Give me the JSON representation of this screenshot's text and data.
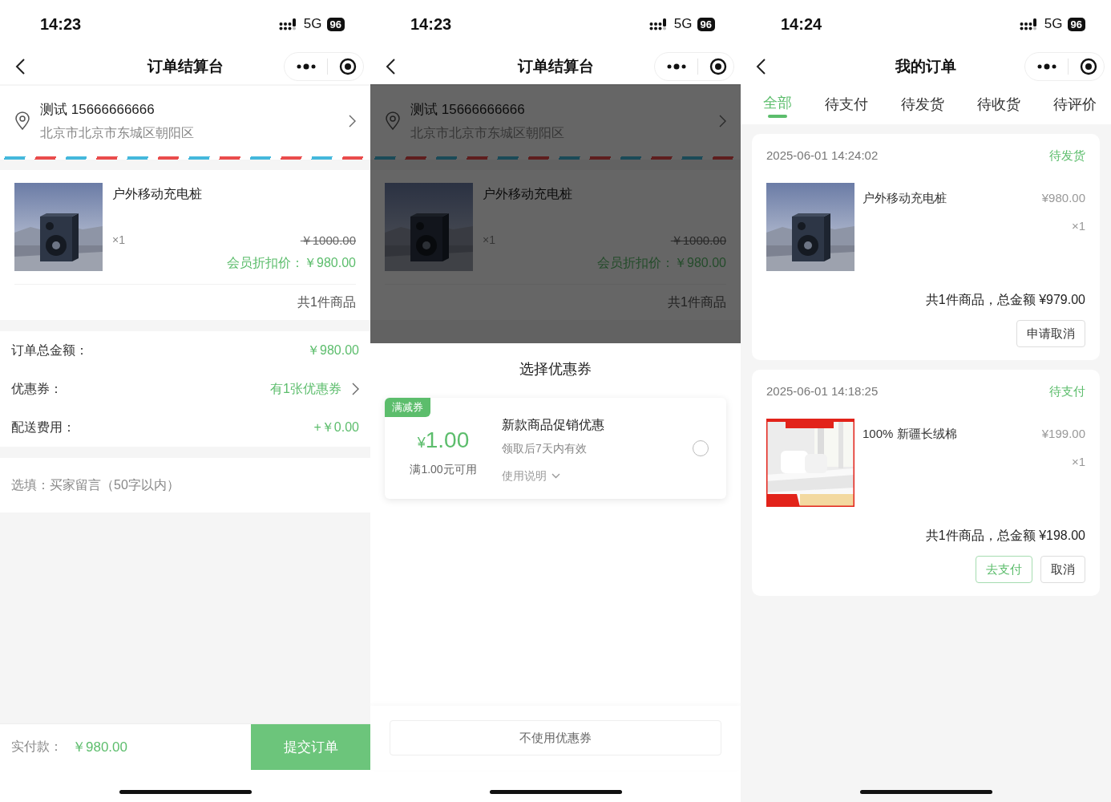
{
  "screens": [
    {
      "kind": "checkout",
      "status": {
        "time": "14:23",
        "network": "5G",
        "battery": "96"
      },
      "title": "订单结算台",
      "address": {
        "name": "测试 15666666666",
        "detail": "北京市北京市东城区朝阳区"
      },
      "items": [
        {
          "name": "户外移动充电桩",
          "qty": "×1",
          "original_price": "￥1000.00",
          "member_price": "会员折扣价：￥980.00"
        }
      ],
      "item_count": "共1件商品",
      "summary": [
        {
          "label": "订单总金额：",
          "value": "￥980.00",
          "link": false
        },
        {
          "label": "优惠券：",
          "value": "有1张优惠券",
          "link": true
        },
        {
          "label": "配送费用：",
          "value": "+￥0.00",
          "link": false
        }
      ],
      "note": {
        "placeholder": "选填：买家留言（50字以内）"
      },
      "footer": {
        "label": "实付款：",
        "amount": "￥980.00",
        "button": "提交订单"
      }
    },
    {
      "kind": "coupon_sheet",
      "status": {
        "time": "14:23",
        "network": "5G",
        "battery": "96"
      },
      "title": "订单结算台",
      "address": {
        "name": "测试 15666666666",
        "detail": "北京市北京市东城区朝阳区"
      },
      "items": [
        {
          "name": "户外移动充电桩",
          "qty": "×1",
          "original_price": "￥1000.00",
          "member_price": "会员折扣价：￥980.00"
        }
      ],
      "item_count": "共1件商品",
      "sheet": {
        "title": "选择优惠券",
        "coupons": [
          {
            "tag": "满减券",
            "currency": "¥",
            "amount": "1.00",
            "condition": "满1.00元可用",
            "name": "新款商品促销优惠",
            "validity": "领取后7天内有效",
            "rules": "使用说明",
            "selected": false
          }
        ],
        "cancel_button": "不使用优惠券"
      }
    },
    {
      "kind": "orders",
      "status": {
        "time": "14:24",
        "network": "5G",
        "battery": "96"
      },
      "title": "我的订单",
      "tabs": [
        {
          "label": "全部",
          "selected": true
        },
        {
          "label": "待支付",
          "selected": false
        },
        {
          "label": "待发货",
          "selected": false
        },
        {
          "label": "待收货",
          "selected": false
        },
        {
          "label": "待评价",
          "selected": false
        }
      ],
      "orders": [
        {
          "time": "2025-06-01 14:24:02",
          "status": "待发货",
          "items": [
            {
              "name": "户外移动充电桩",
              "price": "¥980.00",
              "qty": "×1"
            }
          ],
          "total": "共1件商品，总金额 ¥979.00",
          "actions": [
            {
              "label": "申请取消",
              "kind": "default"
            }
          ]
        },
        {
          "time": "2025-06-01 14:18:25",
          "status": "待支付",
          "items": [
            {
              "name": "100% 新疆长绒棉",
              "price": "¥199.00",
              "qty": "×1"
            }
          ],
          "total": "共1件商品，总金额 ¥198.00",
          "actions": [
            {
              "label": "去支付",
              "kind": "primary"
            },
            {
              "label": "取消",
              "kind": "default"
            }
          ]
        }
      ]
    }
  ]
}
